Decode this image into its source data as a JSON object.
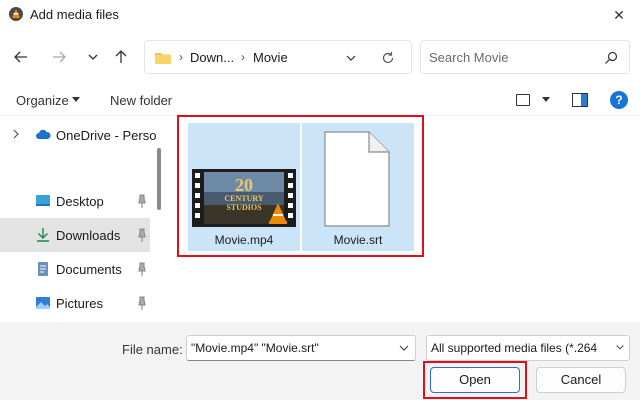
{
  "window": {
    "title": "Add media files",
    "close_glyph": "✕"
  },
  "navbar": {
    "breadcrumbs": [
      "Down...",
      "Movie"
    ],
    "search_placeholder": "Search Movie"
  },
  "commandbar": {
    "organize_label": "Organize",
    "new_folder_label": "New folder",
    "help_glyph": "?"
  },
  "sidebar": {
    "items": [
      {
        "label": "OneDrive - Perso",
        "icon": "cloud-icon"
      },
      {
        "label": "Desktop",
        "icon": "desktop-icon",
        "pinned": true
      },
      {
        "label": "Downloads",
        "icon": "download-icon",
        "pinned": true,
        "selected": true
      },
      {
        "label": "Documents",
        "icon": "document-icon",
        "pinned": true
      },
      {
        "label": "Pictures",
        "icon": "picture-icon",
        "pinned": true
      }
    ]
  },
  "files": [
    {
      "name": "Movie.mp4",
      "icon": "video-thumbnail-icon",
      "selected": true
    },
    {
      "name": "Movie.srt",
      "icon": "blank-file-icon",
      "selected": true
    }
  ],
  "thumbnail": {
    "overlay_lines": [
      "20",
      "CENTURY",
      "STUDIOS"
    ]
  },
  "footer": {
    "file_name_label": "File name:",
    "file_name_value": "\"Movie.mp4\" \"Movie.srt\"",
    "file_type_value": "All supported media files (*.264",
    "open_label": "Open",
    "cancel_label": "Cancel"
  },
  "colors": {
    "selection": "#cce4f7",
    "highlight": "#e0101a",
    "accent": "#1a73d9"
  }
}
